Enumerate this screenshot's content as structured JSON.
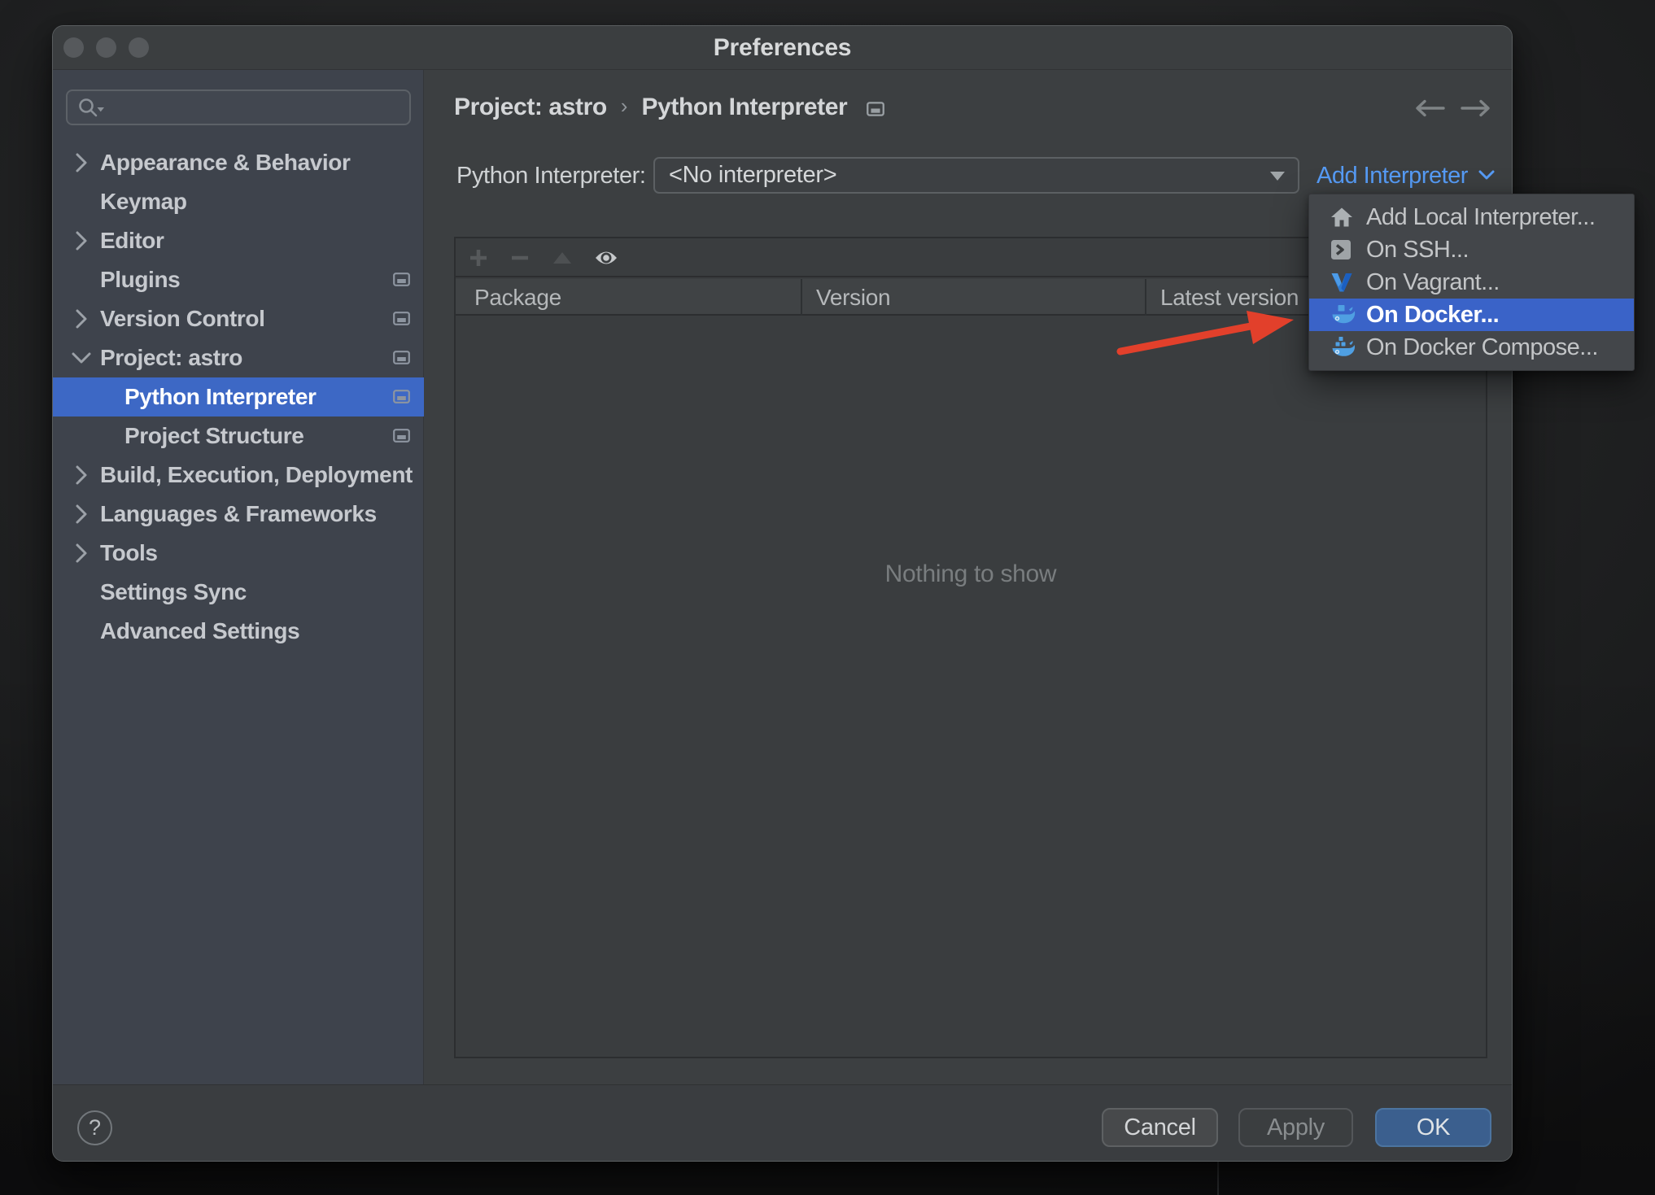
{
  "window": {
    "title": "Preferences",
    "controls": [
      "close",
      "minimize",
      "zoom"
    ]
  },
  "sidebar": {
    "search": {
      "placeholder": "",
      "value": ""
    },
    "items": [
      {
        "label": "Appearance & Behavior",
        "chevron": "right",
        "panel_icon": false,
        "indent": 0,
        "selected": false
      },
      {
        "label": "Keymap",
        "chevron": "none",
        "panel_icon": false,
        "indent": 0,
        "selected": false
      },
      {
        "label": "Editor",
        "chevron": "right",
        "panel_icon": false,
        "indent": 0,
        "selected": false
      },
      {
        "label": "Plugins",
        "chevron": "none",
        "panel_icon": true,
        "indent": 0,
        "selected": false
      },
      {
        "label": "Version Control",
        "chevron": "right",
        "panel_icon": true,
        "indent": 0,
        "selected": false
      },
      {
        "label": "Project: astro",
        "chevron": "down",
        "panel_icon": true,
        "indent": 0,
        "selected": false
      },
      {
        "label": "Python Interpreter",
        "chevron": "none",
        "panel_icon": true,
        "indent": 1,
        "selected": true
      },
      {
        "label": "Project Structure",
        "chevron": "none",
        "panel_icon": true,
        "indent": 1,
        "selected": false
      },
      {
        "label": "Build, Execution, Deployment",
        "chevron": "right",
        "panel_icon": false,
        "indent": 0,
        "selected": false
      },
      {
        "label": "Languages & Frameworks",
        "chevron": "right",
        "panel_icon": false,
        "indent": 0,
        "selected": false
      },
      {
        "label": "Tools",
        "chevron": "right",
        "panel_icon": false,
        "indent": 0,
        "selected": false
      },
      {
        "label": "Settings Sync",
        "chevron": "none",
        "panel_icon": false,
        "indent": 0,
        "selected": false
      },
      {
        "label": "Advanced Settings",
        "chevron": "none",
        "panel_icon": false,
        "indent": 0,
        "selected": false
      }
    ]
  },
  "breadcrumb": {
    "part1": "Project: astro",
    "separator": "›",
    "part2": "Python Interpreter"
  },
  "interpreter_row": {
    "label": "Python Interpreter:",
    "value": "<No interpreter>",
    "add_link": "Add Interpreter"
  },
  "add_interpreter_menu": {
    "items": [
      {
        "label": "Add Local Interpreter...",
        "icon": "home",
        "selected": false
      },
      {
        "label": "On SSH...",
        "icon": "ssh",
        "selected": false
      },
      {
        "label": "On Vagrant...",
        "icon": "vagrant",
        "selected": false
      },
      {
        "label": "On Docker...",
        "icon": "docker",
        "selected": true
      },
      {
        "label": "On Docker Compose...",
        "icon": "docker-compose",
        "selected": false
      }
    ]
  },
  "package_table": {
    "columns": [
      "Package",
      "Version",
      "Latest version"
    ],
    "rows": [],
    "empty_text": "Nothing to show",
    "toolbar": [
      "add",
      "remove",
      "upgrade",
      "show-early-releases"
    ]
  },
  "footer": {
    "help": "?",
    "cancel": "Cancel",
    "apply": "Apply",
    "ok": "OK"
  },
  "colors": {
    "selection_blue": "#3d68c5",
    "menu_selection_blue": "#3a63c8",
    "link_blue": "#569bf5",
    "ok_button_blue": "#3b5f8e",
    "arrow_red": "#e2402b",
    "dialog_bg": "#3c3f41",
    "sidebar_bg": "#3e434c"
  },
  "annotation": {
    "type": "arrow",
    "points_to": "On Docker..."
  }
}
